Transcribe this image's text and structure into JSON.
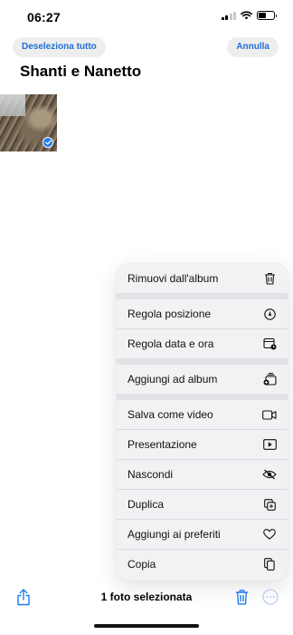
{
  "status_bar": {
    "time": "06:27"
  },
  "header": {
    "deselect_label": "Deseleziona tutto",
    "cancel_label": "Annulla",
    "title": "Shanti e Nanetto"
  },
  "menu": {
    "items": [
      {
        "label": "Rimuovi dall'album",
        "icon": "trash-icon"
      },
      {
        "label": "Regola posizione",
        "icon": "location-icon"
      },
      {
        "label": "Regola data e ora",
        "icon": "calendar-clock-icon"
      },
      {
        "label": "Aggiungi ad album",
        "icon": "add-to-album-icon"
      },
      {
        "label": "Salva come video",
        "icon": "video-icon"
      },
      {
        "label": "Presentazione",
        "icon": "play-icon"
      },
      {
        "label": "Nascondi",
        "icon": "eye-slash-icon"
      },
      {
        "label": "Duplica",
        "icon": "duplicate-icon"
      },
      {
        "label": "Aggiungi ai preferiti",
        "icon": "heart-icon"
      },
      {
        "label": "Copia",
        "icon": "copy-icon"
      }
    ]
  },
  "toolbar": {
    "selection_label": "1 foto selezionata"
  },
  "colors": {
    "accent": "#1f7be8",
    "menu_bg": "#f2f2f4"
  }
}
